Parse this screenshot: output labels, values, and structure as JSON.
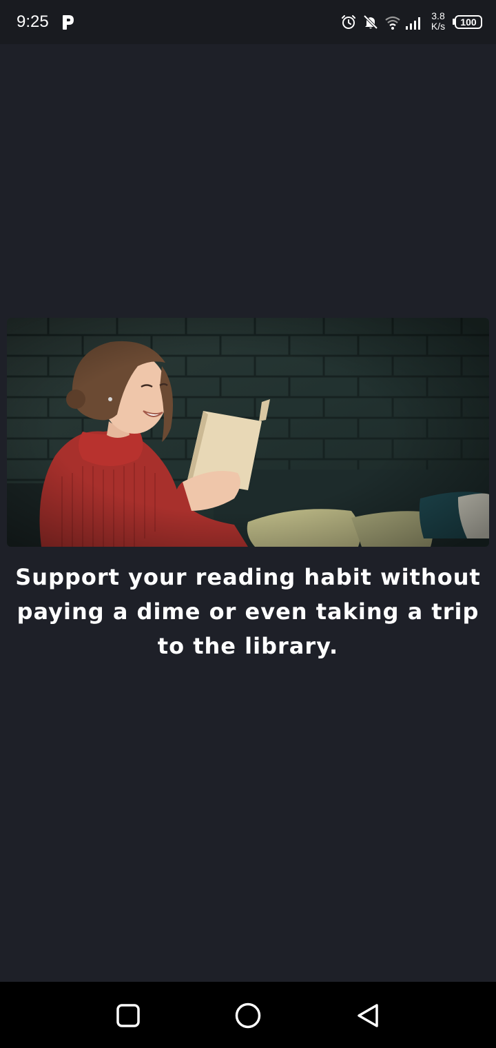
{
  "status_bar": {
    "time": "9:25",
    "net_speed_value": "3.8",
    "net_speed_unit": "K/s",
    "battery_level": "100",
    "icons": [
      "app-p-icon",
      "alarm-icon",
      "bell-off-icon",
      "wifi-icon",
      "signal-icon",
      "battery-icon"
    ]
  },
  "onboarding": {
    "image_alt": "Woman in red sweater smiling while reading a book",
    "tagline": "Support your reading habit without paying a dime or even taking a trip to the library."
  },
  "nav_bar": {
    "buttons": [
      "recents-button",
      "home-button",
      "back-button"
    ]
  },
  "colors": {
    "background": "#1e2028",
    "status_bar": "#191b20",
    "nav_bar": "#000000",
    "text": "#ffffff"
  }
}
